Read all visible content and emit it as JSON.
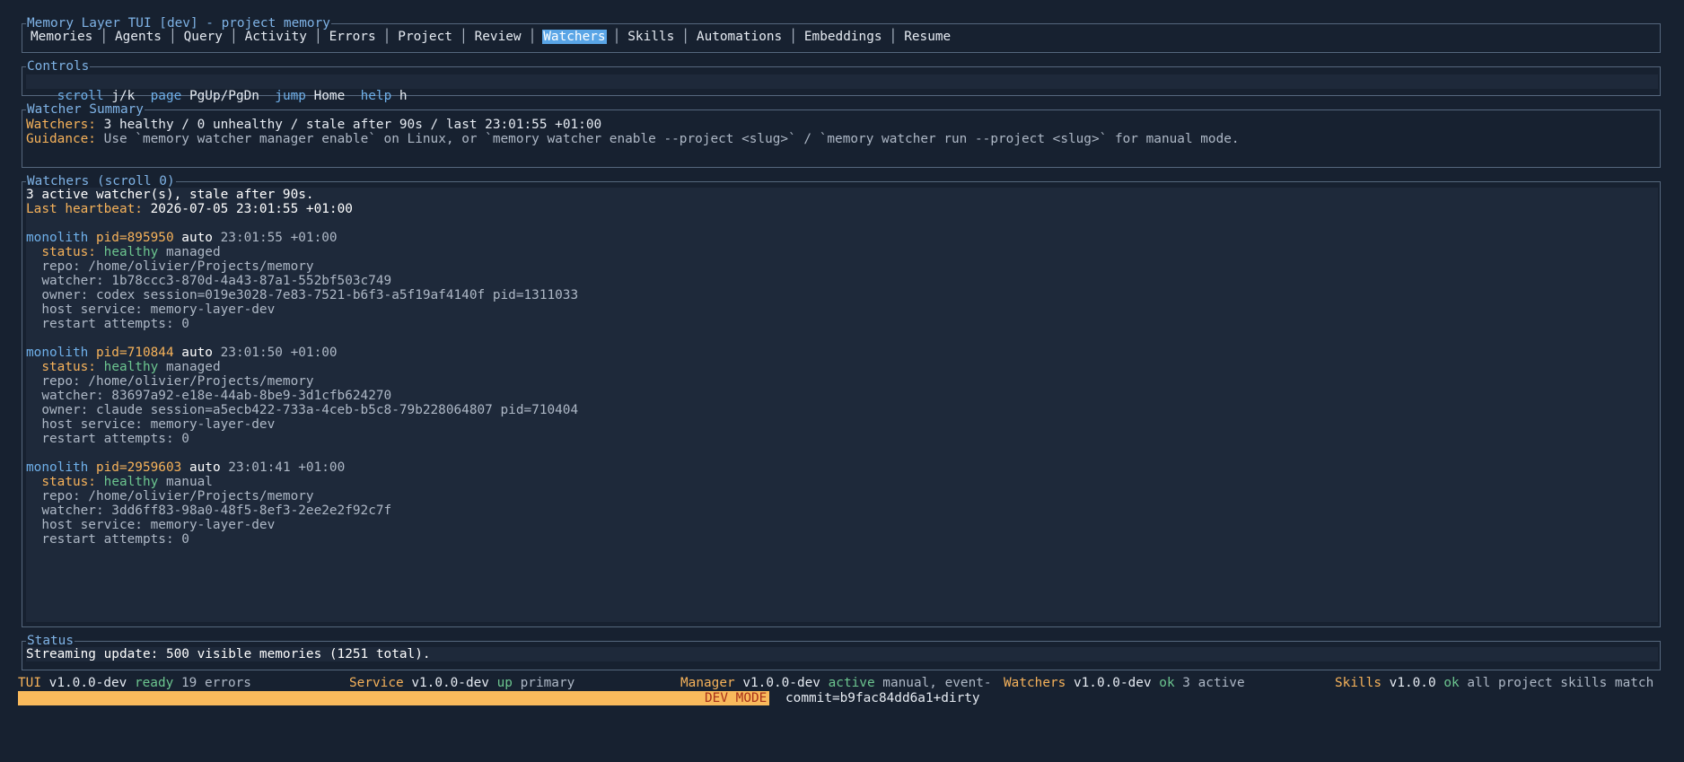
{
  "app": {
    "title": "Memory Layer TUI [dev] - project memory"
  },
  "tabs": [
    "Memories",
    "Agents",
    "Query",
    "Activity",
    "Errors",
    "Project",
    "Review",
    "Watchers",
    "Skills",
    "Automations",
    "Embeddings",
    "Resume"
  ],
  "active_tab": "Watchers",
  "controls": {
    "title": "Controls",
    "scroll_label": "scroll",
    "scroll_key": "j/k",
    "page_label": "page",
    "page_key": "PgUp/PgDn",
    "jump_label": "jump",
    "jump_key": "Home",
    "help_label": "help",
    "help_key": "h"
  },
  "summary": {
    "title": "Watcher Summary",
    "watchers_label": "Watchers:",
    "watchers_value": "3 healthy / 0 unhealthy / stale after 90s / last 23:01:55 +01:00",
    "guidance_label": "Guidance:",
    "guidance_value": "Use `memory watcher manager enable` on Linux, or `memory watcher enable --project <slug>` / `memory watcher run --project <slug>` for manual mode."
  },
  "watchers_panel": {
    "title": "Watchers (scroll 0)",
    "active_line": "3 active watcher(s), stale after 90s.",
    "heartbeat_label": "Last heartbeat:",
    "heartbeat_value": "2026-07-05 23:01:55 +01:00",
    "status_label": "status:",
    "items": [
      {
        "name": "monolith",
        "pid": "pid=895950",
        "mode": "auto",
        "time": "23:01:55 +01:00",
        "status": "healthy",
        "management": "managed",
        "repo": "repo: /home/olivier/Projects/memory",
        "watcher": "watcher: 1b78ccc3-870d-4a43-87a1-552bf503c749",
        "owner": "owner: codex session=019e3028-7e83-7521-b6f3-a5f19af4140f pid=1311033",
        "host": "host service: memory-layer-dev",
        "restarts": "restart attempts: 0"
      },
      {
        "name": "monolith",
        "pid": "pid=710844",
        "mode": "auto",
        "time": "23:01:50 +01:00",
        "status": "healthy",
        "management": "managed",
        "repo": "repo: /home/olivier/Projects/memory",
        "watcher": "watcher: 83697a92-e18e-44ab-8be9-3d1cfb624270",
        "owner": "owner: claude session=a5ecb422-733a-4ceb-b5c8-79b228064807 pid=710404",
        "host": "host service: memory-layer-dev",
        "restarts": "restart attempts: 0"
      },
      {
        "name": "monolith",
        "pid": "pid=2959603",
        "mode": "auto",
        "time": "23:01:41 +01:00",
        "status": "healthy",
        "management": "manual",
        "repo": "repo: /home/olivier/Projects/memory",
        "watcher": "watcher: 3dd6ff83-98a0-48f5-8ef3-2ee2e2f92c7f",
        "host": "host service: memory-layer-dev",
        "restarts": "restart attempts: 0"
      }
    ]
  },
  "status": {
    "title": "Status",
    "message": "Streaming update: 500 visible memories (1251 total)."
  },
  "footer": {
    "tui": {
      "label": "TUI",
      "version": "v1.0.0-dev",
      "state": "ready",
      "detail": "19 errors"
    },
    "service": {
      "label": "Service",
      "version": "v1.0.0-dev",
      "state": "up",
      "detail": "primary"
    },
    "manager": {
      "label": "Manager",
      "version": "v1.0.0-dev",
      "state": "active",
      "detail": "manual, event-"
    },
    "watchers": {
      "label": "Watchers",
      "version": "v1.0.0-dev",
      "state": "ok",
      "detail": "3 active"
    },
    "skills": {
      "label": "Skills",
      "version": "v1.0.0",
      "state": "ok",
      "detail": "all project skills match"
    },
    "dev_mode": "DEV MODE",
    "commit": "commit=b9fac84dd6a1+dirty"
  },
  "colors": {
    "background": "#172130",
    "panel": "#1e293a",
    "border": "#55677d",
    "accent": "#f6b25a",
    "blue": "#6fb0ea",
    "ok": "#6cc58f",
    "active_tab": "#5aa5e6",
    "dev_bar": "#f9ba5c"
  }
}
